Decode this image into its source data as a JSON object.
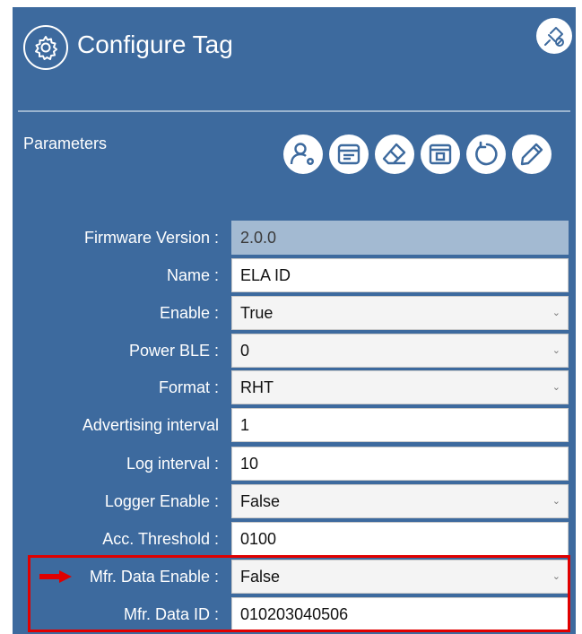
{
  "header": {
    "title": "Configure Tag",
    "settings_icon": "gear-icon",
    "pin_icon": "unpin-icon"
  },
  "parameters": {
    "label": "Parameters",
    "toolbar": [
      "user-settings-icon",
      "card-icon",
      "eraser-icon",
      "config-window-icon",
      "refresh-icon",
      "edit-icon"
    ]
  },
  "fields": {
    "firmware_version": {
      "label": "Firmware Version :",
      "value": "2.0.0"
    },
    "name": {
      "label": "Name :",
      "value": "ELA ID"
    },
    "enable": {
      "label": "Enable :",
      "value": "True"
    },
    "power_ble": {
      "label": "Power BLE :",
      "value": "0"
    },
    "format": {
      "label": "Format :",
      "value": "RHT"
    },
    "advertising_interval": {
      "label": "Advertising interval",
      "value": "1"
    },
    "log_interval": {
      "label": "Log interval :",
      "value": "10"
    },
    "logger_enable": {
      "label": "Logger Enable :",
      "value": "False"
    },
    "acc_threshold": {
      "label": "Acc. Threshold :",
      "value": "0100"
    },
    "mfr_data_enable": {
      "label": "Mfr. Data Enable :",
      "value": "False"
    },
    "mfr_data_id": {
      "label": "Mfr. Data ID :",
      "value": "010203040506"
    }
  },
  "colors": {
    "panel": "#3d6a9e",
    "highlight": "#e00000",
    "readonly_field": "#a3bad2"
  }
}
